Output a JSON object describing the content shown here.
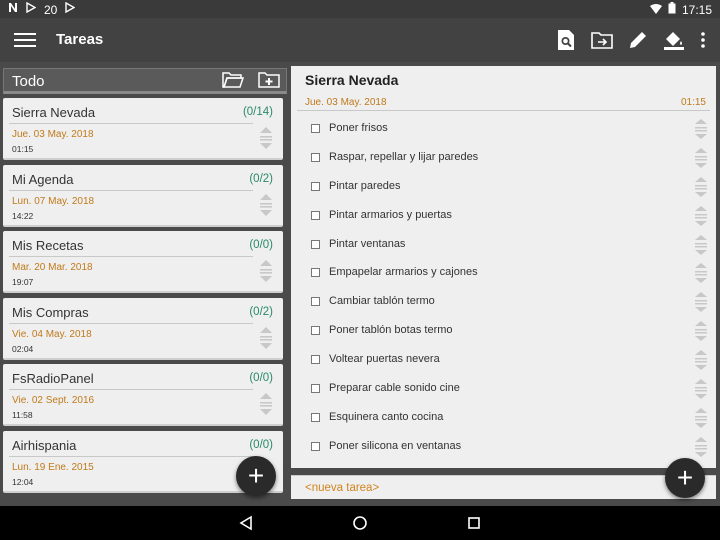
{
  "statusbar": {
    "left_icons": [
      "notification-n-icon",
      "play-store-icon",
      "play-store-icon"
    ],
    "badge_number": "20",
    "time": "17:15"
  },
  "appbar": {
    "title": "Tareas",
    "actions": [
      "search-document-icon",
      "folder-move-icon",
      "pencil-icon",
      "paint-bucket-icon",
      "more-vert-icon"
    ]
  },
  "left": {
    "header_title": "Todo",
    "lists": [
      {
        "name": "Sierra Nevada",
        "count": "(0/14)",
        "date": "Jue. 03 May. 2018",
        "time": "01:15"
      },
      {
        "name": "Mi Agenda",
        "count": "(0/2)",
        "date": "Lun. 07 May. 2018",
        "time": "14:22"
      },
      {
        "name": "Mis Recetas",
        "count": "(0/0)",
        "date": "Mar. 20 Mar. 2018",
        "time": "19:07"
      },
      {
        "name": "Mis Compras",
        "count": "(0/2)",
        "date": "Vie. 04 May. 2018",
        "time": "02:04"
      },
      {
        "name": "FsRadioPanel",
        "count": "(0/0)",
        "date": "Vie. 02 Sept. 2016",
        "time": "11:58"
      },
      {
        "name": "Airhispania",
        "count": "(0/0)",
        "date": "Lun. 19 Ene. 2015",
        "time": "12:04"
      }
    ],
    "fab_label": "+"
  },
  "right": {
    "title": "Sierra Nevada",
    "date": "Jue. 03 May. 2018",
    "time": "01:15",
    "tasks": [
      "Poner frisos",
      "Raspar, repellar y lijar paredes",
      "Pintar paredes",
      "Pintar armarios y puertas",
      "Pintar ventanas",
      "Empapelar armarios y cajones",
      "Cambiar tablón termo",
      "Poner tablón botas termo",
      "Voltear puertas nevera",
      "Preparar cable sonido cine",
      "Esquinera canto cocina",
      "Poner silicona en ventanas"
    ],
    "new_task_placeholder": "<nueva tarea>",
    "fab_label": "+"
  },
  "colors": {
    "accent_date": "#c07a1a",
    "count_green": "#2a8a6a",
    "appbar": "#424242"
  }
}
